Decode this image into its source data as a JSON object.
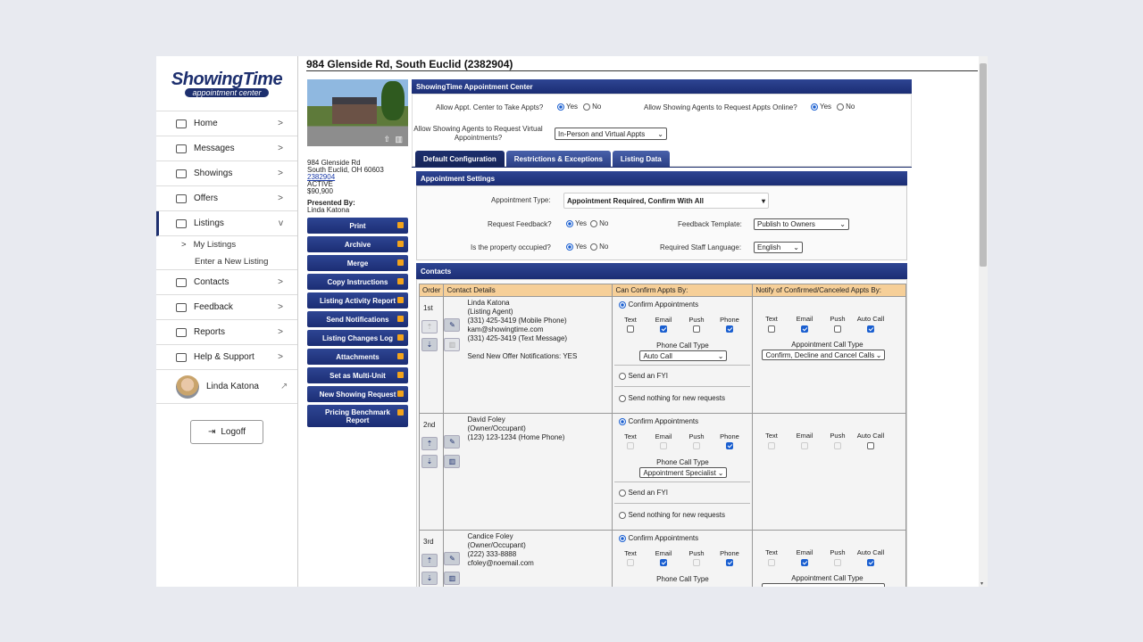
{
  "sidebar": {
    "logo_top": "ShowingTime",
    "logo_sub": "appointment center",
    "items": [
      {
        "label": "Home",
        "icon": "home-icon",
        "chev": ">"
      },
      {
        "label": "Messages",
        "icon": "messages-icon",
        "chev": ">"
      },
      {
        "label": "Showings",
        "icon": "calendar-icon",
        "chev": ">"
      },
      {
        "label": "Offers",
        "icon": "offers-icon",
        "chev": ">"
      },
      {
        "label": "Listings",
        "icon": "listings-icon",
        "chev": "v"
      }
    ],
    "sub_items": [
      {
        "label": "My Listings",
        "marker": ">"
      },
      {
        "label": "Enter a New Listing",
        "marker": ""
      }
    ],
    "items2": [
      {
        "label": "Contacts",
        "icon": "contacts-icon",
        "chev": ">"
      },
      {
        "label": "Feedback",
        "icon": "feedback-icon",
        "chev": ">"
      },
      {
        "label": "Reports",
        "icon": "reports-icon",
        "chev": ">"
      },
      {
        "label": "Help & Support",
        "icon": "help-icon",
        "chev": ">"
      }
    ],
    "user_name": "Linda Katona",
    "logoff": "Logoff"
  },
  "property": {
    "title": "984 Glenside Rd, South Euclid (2382904)",
    "addr1": "984 Glenside Rd",
    "addr2": "South Euclid, OH 60603",
    "mls": "2382904",
    "status": "ACTIVE",
    "price": "$90,900",
    "presented_label": "Presented By:",
    "presented_name": "Linda Katona"
  },
  "actions": [
    "Print",
    "Archive",
    "Merge",
    "Copy Instructions",
    "Listing Activity Report",
    "Send Notifications",
    "Listing Changes Log",
    "Attachments",
    "Set as Multi-Unit",
    "New Showing Request",
    "Pricing Benchmark Report"
  ],
  "appt_center": {
    "header": "ShowingTime Appointment Center",
    "allow_take_label": "Allow Appt. Center to Take Appts?",
    "allow_online_label": "Allow Showing Agents to Request Appts Online?",
    "allow_virtual_label": "Allow Showing Agents to Request Virtual Appointments?",
    "virtual_value": "In-Person and Virtual Appts",
    "yes": "Yes",
    "no": "No"
  },
  "tabs": [
    "Default Configuration",
    "Restrictions & Exceptions",
    "Listing Data"
  ],
  "settings": {
    "header": "Appointment Settings",
    "type_label": "Appointment Type:",
    "type_value": "Appointment Required, Confirm With All",
    "feedback_label": "Request Feedback?",
    "template_label": "Feedback Template:",
    "template_value": "Publish to Owners",
    "occupied_label": "Is the property occupied?",
    "language_label": "Required Staff Language:",
    "language_value": "English"
  },
  "contacts": {
    "header": "Contacts",
    "columns": [
      "Order",
      "Contact Details",
      "Can Confirm Appts By:",
      "Notify of Confirmed/Canceled Appts By:"
    ],
    "methods": [
      "Text",
      "Email",
      "Push",
      "Phone"
    ],
    "notify_methods": [
      "Text",
      "Email",
      "Push",
      "Auto Call"
    ],
    "confirm_label": "Confirm Appointments",
    "fyi_label": "Send an FYI",
    "nothing_label": "Send nothing for new requests",
    "phone_call_type_label": "Phone Call Type",
    "appt_call_type_label": "Appointment Call Type",
    "rows": [
      {
        "order": "1st",
        "lines": [
          "Linda Katona",
          "(Listing Agent)",
          "(331) 425-3419 (Mobile Phone)",
          "kam@showingtime.com",
          "(331) 425-3419 (Text Message)",
          "",
          "Send New Offer Notifications: YES"
        ],
        "phone_type": "Auto Call",
        "appt_type": "Confirm, Decline and Cancel Calls"
      },
      {
        "order": "2nd",
        "lines": [
          "David Foley",
          "(Owner/Occupant)",
          "(123) 123-1234 (Home Phone)"
        ],
        "phone_type": "Appointment Specialist",
        "appt_type": ""
      },
      {
        "order": "3rd",
        "lines": [
          "Candice Foley",
          "(Owner/Occupant)",
          "(222) 333-8888",
          "cfoley@noemail.com"
        ],
        "phone_type": "",
        "appt_type": ""
      }
    ]
  }
}
